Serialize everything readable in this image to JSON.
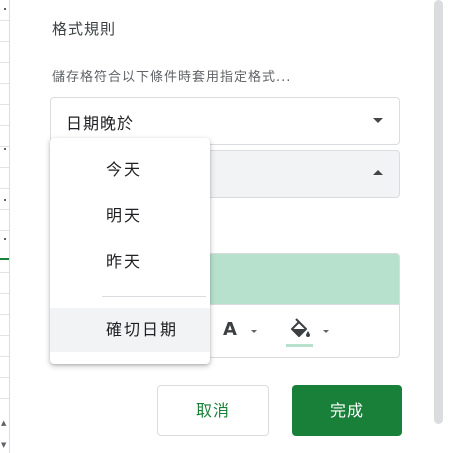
{
  "panel": {
    "section_title": "格式規則",
    "hint": "儲存格符合以下條件時套用指定格式...",
    "condition_select": {
      "value": "日期晚於"
    },
    "date_menu": {
      "items": [
        {
          "label": "今天",
          "selected": false
        },
        {
          "label": "明天",
          "selected": false
        },
        {
          "label": "昨天",
          "selected": false
        },
        {
          "label": "確切日期",
          "selected": true
        }
      ]
    },
    "formatting_style": {
      "preview_color": "#b7e1cd",
      "toolbar": [
        {
          "icon": "text-color-icon",
          "glyph": "A"
        },
        {
          "icon": "fill-color-icon",
          "color": "#b7e1cd"
        }
      ]
    },
    "buttons": {
      "cancel_label": "取消",
      "done_label": "完成"
    }
  },
  "theme": {
    "accent": "#188038",
    "border": "#dadce0"
  }
}
